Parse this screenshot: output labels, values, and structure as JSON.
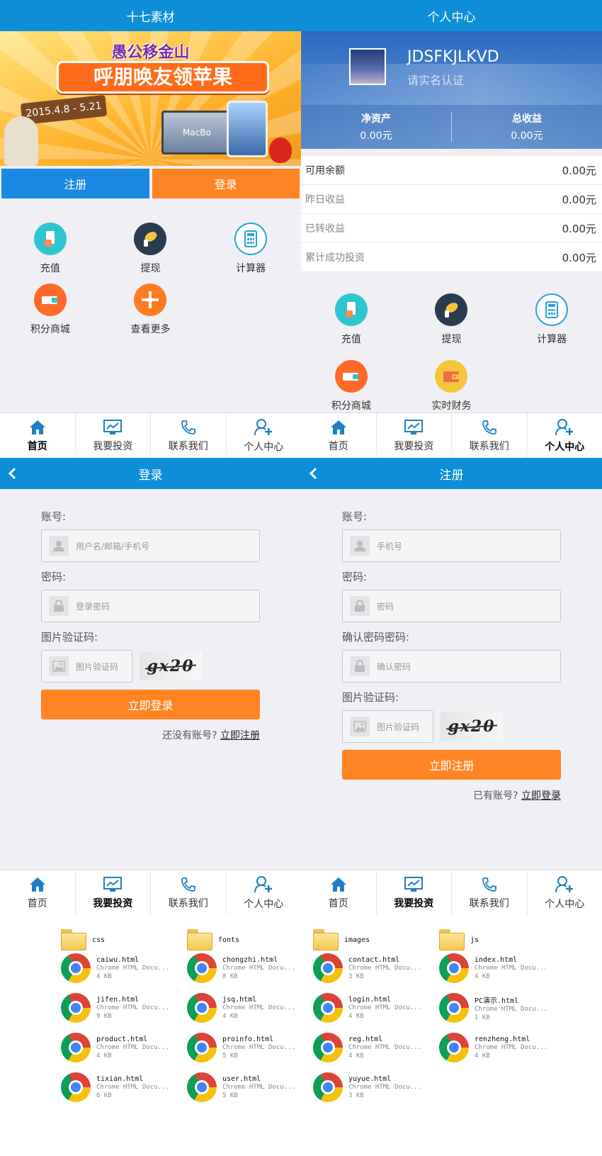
{
  "home": {
    "title": "十七素材",
    "banner": {
      "top_text": "愚公移金山",
      "main_text": "呼朋唤友领苹果",
      "date_text": "2015.4.8 - 5.21",
      "laptop_text": "MacBo"
    },
    "register_label": "注册",
    "login_label": "登录",
    "icons": [
      {
        "label": "充值",
        "icon": "recharge-icon"
      },
      {
        "label": "提现",
        "icon": "withdraw-icon"
      },
      {
        "label": "计算器",
        "icon": "calculator-icon"
      },
      {
        "label": "积分商城",
        "icon": "points-mall-icon"
      },
      {
        "label": "查看更多",
        "icon": "plus-icon"
      }
    ]
  },
  "user": {
    "title": "个人中心",
    "username": "JDSFKJLKVD",
    "verify_text": "请实名认证",
    "net_assets_label": "净资产",
    "net_assets_value": "0.00元",
    "total_income_label": "总收益",
    "total_income_value": "0.00元",
    "balances": [
      {
        "label": "可用余额",
        "value": "0.00元"
      },
      {
        "label": "昨日收益",
        "value": "0.00元"
      },
      {
        "label": "已转收益",
        "value": "0.00元"
      },
      {
        "label": "累计成功投资",
        "value": "0.00元"
      }
    ],
    "icons": [
      {
        "label": "充值",
        "icon": "recharge-icon"
      },
      {
        "label": "提现",
        "icon": "withdraw-icon"
      },
      {
        "label": "计算器",
        "icon": "calculator-icon"
      },
      {
        "label": "积分商城",
        "icon": "points-mall-icon"
      },
      {
        "label": "实时财务",
        "icon": "wallet-icon"
      }
    ]
  },
  "login": {
    "title": "登录",
    "account_label": "账号:",
    "account_placeholder": "用户名/邮箱/手机号",
    "password_label": "密码:",
    "password_placeholder": "登录密码",
    "captcha_label": "图片验证码:",
    "captcha_placeholder": "图片验证码",
    "captcha_text": "gx20",
    "submit_label": "立即登录",
    "switch_text": "还没有账号?",
    "switch_link": "立即注册"
  },
  "register": {
    "title": "注册",
    "account_label": "账号:",
    "account_placeholder": "手机号",
    "password_label": "密码:",
    "password_placeholder": "密码",
    "confirm_label": "确认密码密码:",
    "confirm_placeholder": "确认密码",
    "captcha_label": "图片验证码:",
    "captcha_placeholder": "图片验证码",
    "captcha_text": "gx20",
    "submit_label": "立即注册",
    "switch_text": "已有账号?",
    "switch_link": "立即登录"
  },
  "tabs": [
    "首页",
    "我要投资",
    "联系我们",
    "个人中心"
  ],
  "files": [
    {
      "name": "css",
      "type": "folder"
    },
    {
      "name": "fonts",
      "type": "folder"
    },
    {
      "name": "images",
      "type": "folder"
    },
    {
      "name": "js",
      "type": "folder"
    },
    {
      "name": "caiwu.html",
      "desc": "Chrome HTML Docu...",
      "size": "4 KB",
      "type": "html"
    },
    {
      "name": "chongzhi.html",
      "desc": "Chrome HTML Docu...",
      "size": "8 KB",
      "type": "html"
    },
    {
      "name": "contact.html",
      "desc": "Chrome HTML Docu...",
      "size": "3 KB",
      "type": "html"
    },
    {
      "name": "index.html",
      "desc": "Chrome HTML Docu...",
      "size": "4 KB",
      "type": "html"
    },
    {
      "name": "jifen.html",
      "desc": "Chrome HTML Docu...",
      "size": "9 KB",
      "type": "html"
    },
    {
      "name": "jsq.html",
      "desc": "Chrome HTML Docu...",
      "size": "4 KB",
      "type": "html"
    },
    {
      "name": "login.html",
      "desc": "Chrome HTML Docu...",
      "size": "4 KB",
      "type": "html"
    },
    {
      "name": "PC演示.html",
      "desc": "Chrome HTML Docu...",
      "size": "1 KB",
      "type": "html"
    },
    {
      "name": "product.html",
      "desc": "Chrome HTML Docu...",
      "size": "4 KB",
      "type": "html"
    },
    {
      "name": "proinfo.html",
      "desc": "Chrome HTML Docu...",
      "size": "5 KB",
      "type": "html"
    },
    {
      "name": "reg.html",
      "desc": "Chrome HTML Docu...",
      "size": "4 KB",
      "type": "html"
    },
    {
      "name": "renzheng.html",
      "desc": "Chrome HTML Docu...",
      "size": "4 KB",
      "type": "html"
    },
    {
      "name": "tixian.html",
      "desc": "Chrome HTML Docu...",
      "size": "6 KB",
      "type": "html"
    },
    {
      "name": "user.html",
      "desc": "Chrome HTML Docu...",
      "size": "5 KB",
      "type": "html"
    },
    {
      "name": "yuyue.html",
      "desc": "Chrome HTML Docu...",
      "size": "3 KB",
      "type": "html"
    }
  ],
  "colors": {
    "header_blue": "#0d8fd8",
    "register_blue": "#1a87e0",
    "accent_orange": "#ff8524",
    "tab_icon_blue": "#1f7fc4"
  }
}
